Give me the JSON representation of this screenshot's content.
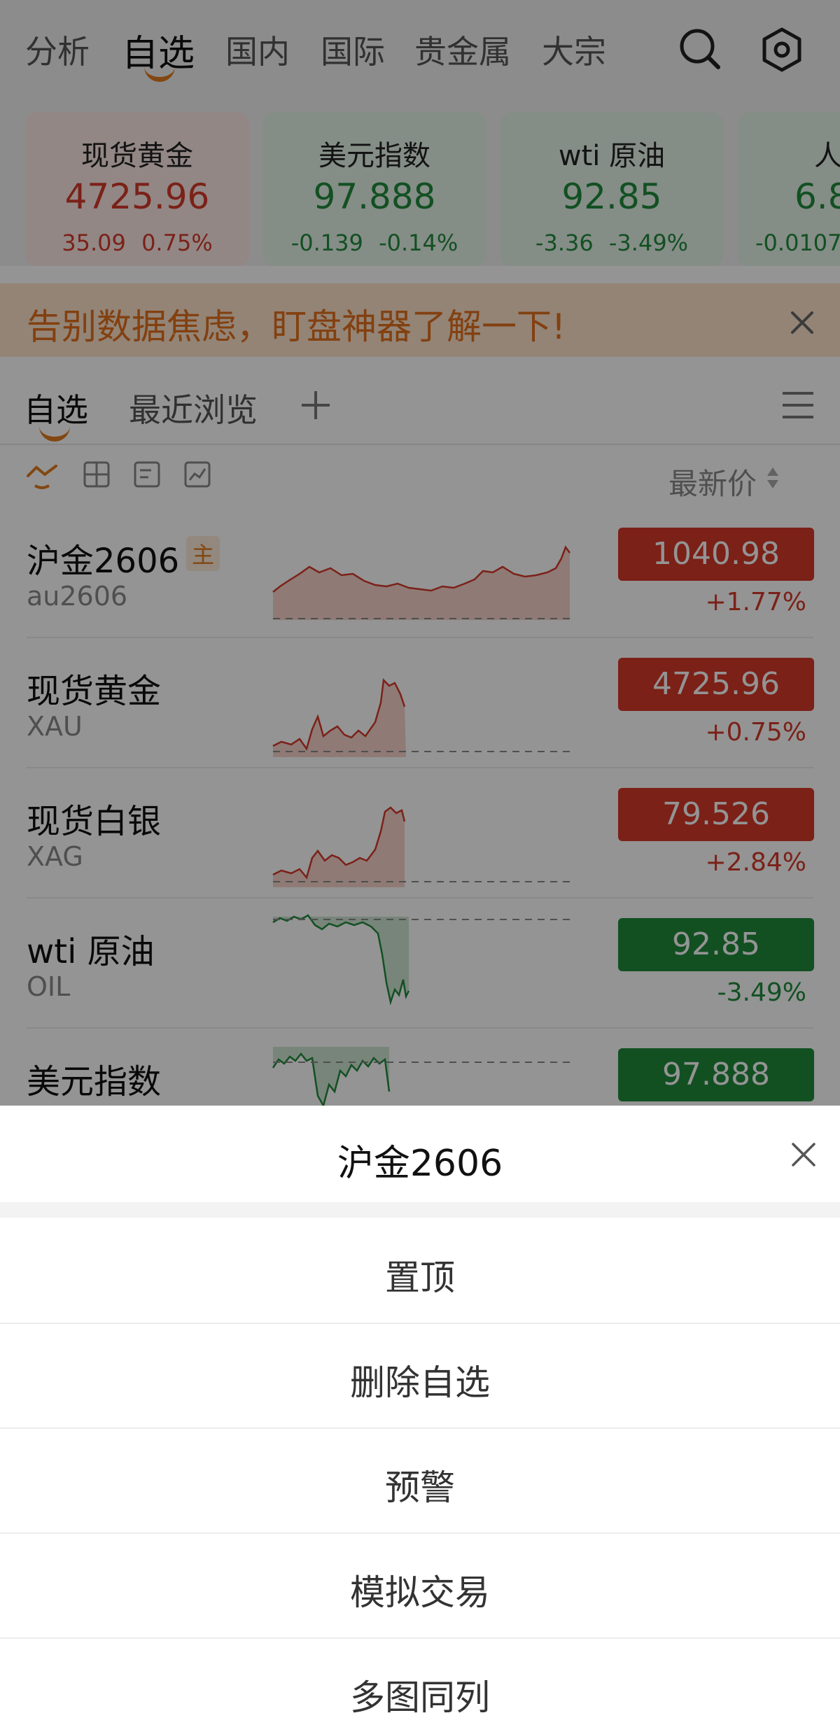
{
  "nav": {
    "tabs": [
      "分析",
      "自选",
      "国内",
      "国际",
      "贵金属",
      "大宗"
    ],
    "active": "自选",
    "search_icon": "search-icon",
    "settings_icon": "settings-hexagon-icon"
  },
  "cards": [
    {
      "name": "现货黄金",
      "price": "4725.96",
      "change": "35.09",
      "pct": "0.75%",
      "trend": "up"
    },
    {
      "name": "美元指数",
      "price": "97.888",
      "change": "-0.139",
      "pct": "-0.14%",
      "trend": "down"
    },
    {
      "name": "wti 原油",
      "price": "92.85",
      "change": "-3.36",
      "pct": "-3.49%",
      "trend": "down"
    },
    {
      "name": "人民",
      "price": "6.8",
      "change": "-0.0107",
      "pct": "",
      "trend": "down"
    }
  ],
  "banner": {
    "text": "告别数据焦虑，盯盘神器了解一下!",
    "close_icon": "close-icon"
  },
  "watchlist": {
    "tabs": [
      "自选",
      "最近浏览"
    ],
    "add_icon": "plus-icon",
    "menu_icon": "list-menu-icon",
    "sort_label": "最新价",
    "view_icons": [
      "line-chart-view-icon",
      "grid-view-icon",
      "card-view-icon",
      "chart-view-icon"
    ]
  },
  "rows": [
    {
      "name": "沪金2606",
      "code": "au2606",
      "badge": "主",
      "price": "1040.98",
      "pct": "+1.77%",
      "trend": "up"
    },
    {
      "name": "现货黄金",
      "code": "XAU",
      "badge": "",
      "price": "4725.96",
      "pct": "+0.75%",
      "trend": "up"
    },
    {
      "name": "现货白银",
      "code": "XAG",
      "badge": "",
      "price": "79.526",
      "pct": "+2.84%",
      "trend": "up"
    },
    {
      "name": "wti 原油",
      "code": "OIL",
      "badge": "",
      "price": "92.85",
      "pct": "-3.49%",
      "trend": "down"
    },
    {
      "name": "美元指数",
      "code": "",
      "badge": "",
      "price": "97.888",
      "pct": "",
      "trend": "down"
    }
  ],
  "sheet": {
    "title": "沪金2606",
    "close_icon": "close-icon",
    "options": [
      "置顶",
      "删除自选",
      "预警",
      "模拟交易",
      "多图同列"
    ]
  },
  "colors": {
    "up": "#d53a2a",
    "down": "#1f8a3b",
    "accent": "#e07b1e"
  }
}
